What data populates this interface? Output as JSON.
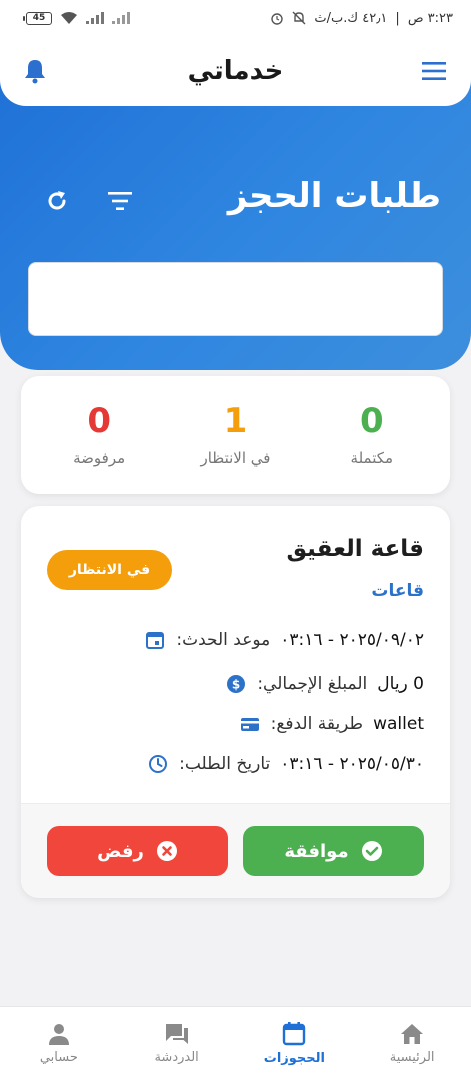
{
  "status_bar": {
    "time": "٣:٢٣ ص",
    "network_speed": "٤٢٫١ ك.ب/ث",
    "battery": "45"
  },
  "app": {
    "title": "خدماتي"
  },
  "page": {
    "title": "طلبات الحجز",
    "search_value": ""
  },
  "stats": [
    {
      "label": "مكتملة",
      "value": "0",
      "color": "#4caf50"
    },
    {
      "label": "في الانتظار",
      "value": "1",
      "color": "#f59e0b"
    },
    {
      "label": "مرفوضة",
      "value": "0",
      "color": "#e53935"
    }
  ],
  "booking": {
    "venue_name": "قاعة العقيق",
    "category": "قاعات",
    "status": "في الانتظار",
    "event_date_label": "موعد الحدث:",
    "event_date_value": "٢٠٢٥/٠٩/٠٢ - ٠٣:١٦",
    "amount_label": "المبلغ الإجمالي:",
    "amount_value": "0 ريال",
    "payment_label": "طريقة الدفع:",
    "payment_value": "wallet",
    "request_date_label": "تاريخ الطلب:",
    "request_date_value": "٢٠٢٥/٠٥/٣٠ - ٠٣:١٦",
    "approve_label": "موافقة",
    "reject_label": "رفض"
  },
  "bottom_nav": {
    "items": [
      {
        "label": "الرئيسية",
        "icon": "home-icon"
      },
      {
        "label": "الحجوزات",
        "icon": "calendar-icon",
        "active": true
      },
      {
        "label": "الدردشة",
        "icon": "chat-icon"
      },
      {
        "label": "حسابي",
        "icon": "person-icon"
      }
    ]
  },
  "colors": {
    "primary": "#1e6fd6",
    "approve": "#4caf50",
    "reject": "#f0463b",
    "pending": "#f59e0b"
  }
}
